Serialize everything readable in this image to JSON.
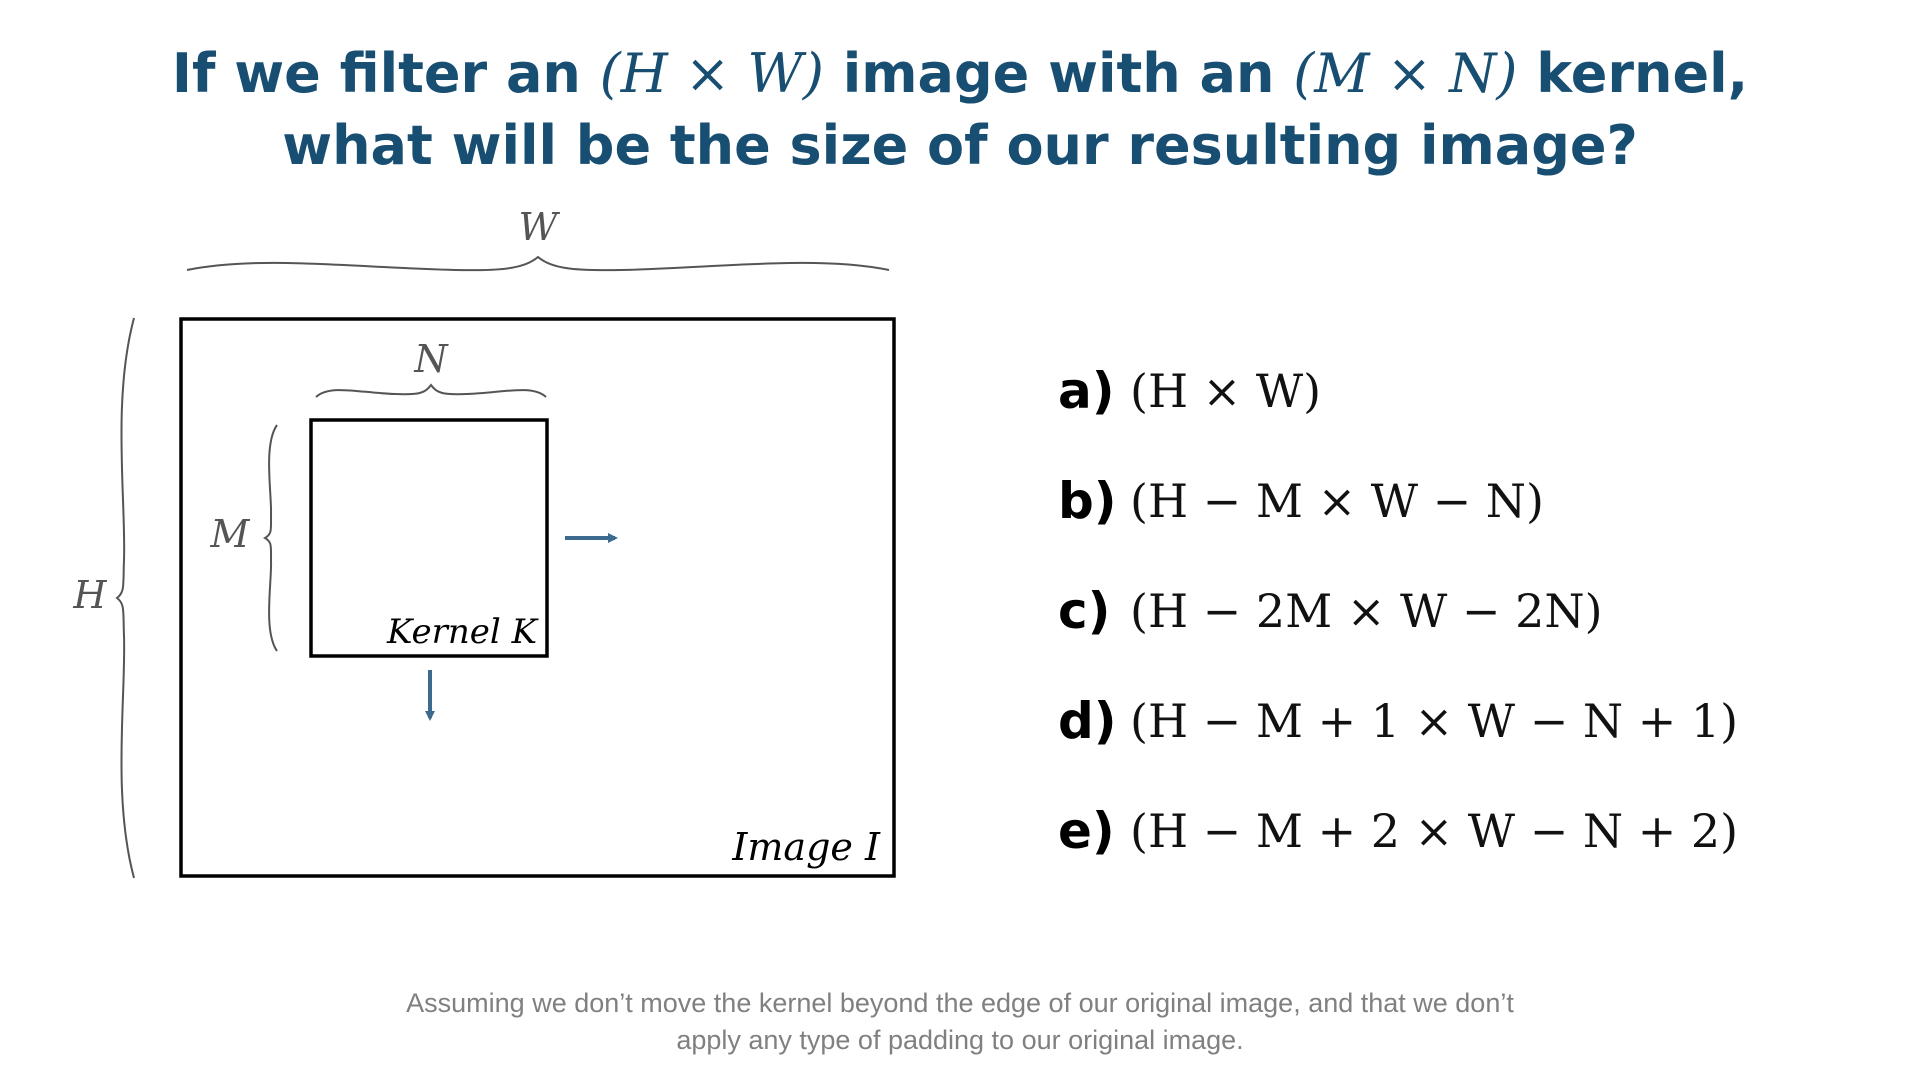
{
  "title": {
    "line1_a": "If we filter an ",
    "line1_m1": "(H × W)",
    "line1_b": " image with an ",
    "line1_m2": "(M × N)",
    "line1_c": " kernel,",
    "line2": "what will be the size of our resulting image?"
  },
  "diagram": {
    "image_width_label": "W",
    "image_height_label": "H",
    "kernel_width_label": "N",
    "kernel_height_label": "M",
    "kernel_label": "Kernel K",
    "image_label": "Image I",
    "arrow_color": "#3d6b90"
  },
  "options": [
    {
      "letter": "a)",
      "expr": "(H × W)"
    },
    {
      "letter": "b)",
      "expr": "(H − M × W − N)"
    },
    {
      "letter": "c)",
      "expr": "(H − 2M × W − 2N)"
    },
    {
      "letter": "d)",
      "expr": "(H − M + 1 × W − N + 1)"
    },
    {
      "letter": "e)",
      "expr": "(H − M + 2 × W − N + 2)"
    }
  ],
  "footnote": {
    "line1": "Assuming we don’t move the kernel beyond the edge of our original image, and that we don’t",
    "line2": "apply any type of padding to our original image."
  }
}
